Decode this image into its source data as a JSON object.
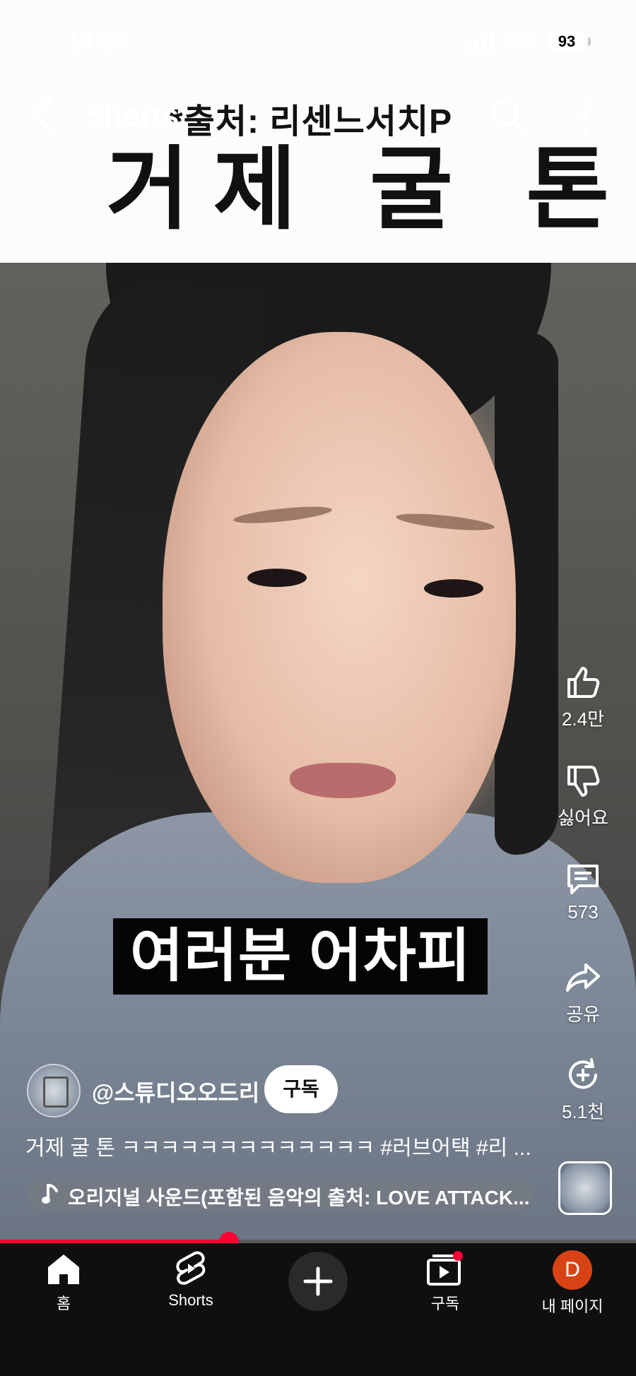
{
  "status_bar": {
    "time": "13:55",
    "network": "5G",
    "battery": "93"
  },
  "top_bar": {
    "title": "Shorts"
  },
  "video_overlay": {
    "source_text": "*출처: 리센느서치P",
    "big_title": "거제 굴 톤",
    "caption": "여러분 어차피"
  },
  "actions": {
    "like_count": "2.4만",
    "dislike_label": "싫어요",
    "comment_count": "573",
    "share_label": "공유",
    "remix_count": "5.1천"
  },
  "channel": {
    "name": "@스튜디오오드리",
    "subscribe_label": "구독"
  },
  "description": "거제 굴 톤 ㅋㅋㅋㅋㅋㅋㅋㅋㅋㅋㅋㅋㅋ #러브어택 #리 ...",
  "sound": {
    "label": "오리지널 사운드(포함된 음악의 출처: LOVE ATTACK..."
  },
  "progress": {
    "fraction": 0.36
  },
  "bottom_nav": {
    "home": "홈",
    "shorts": "Shorts",
    "subscriptions": "구독",
    "profile_initial": "D",
    "my_page": "내 페이지"
  },
  "colors": {
    "accent": "#ff0033",
    "nav_bg": "#0f0f0f",
    "profile": "#d84315"
  }
}
